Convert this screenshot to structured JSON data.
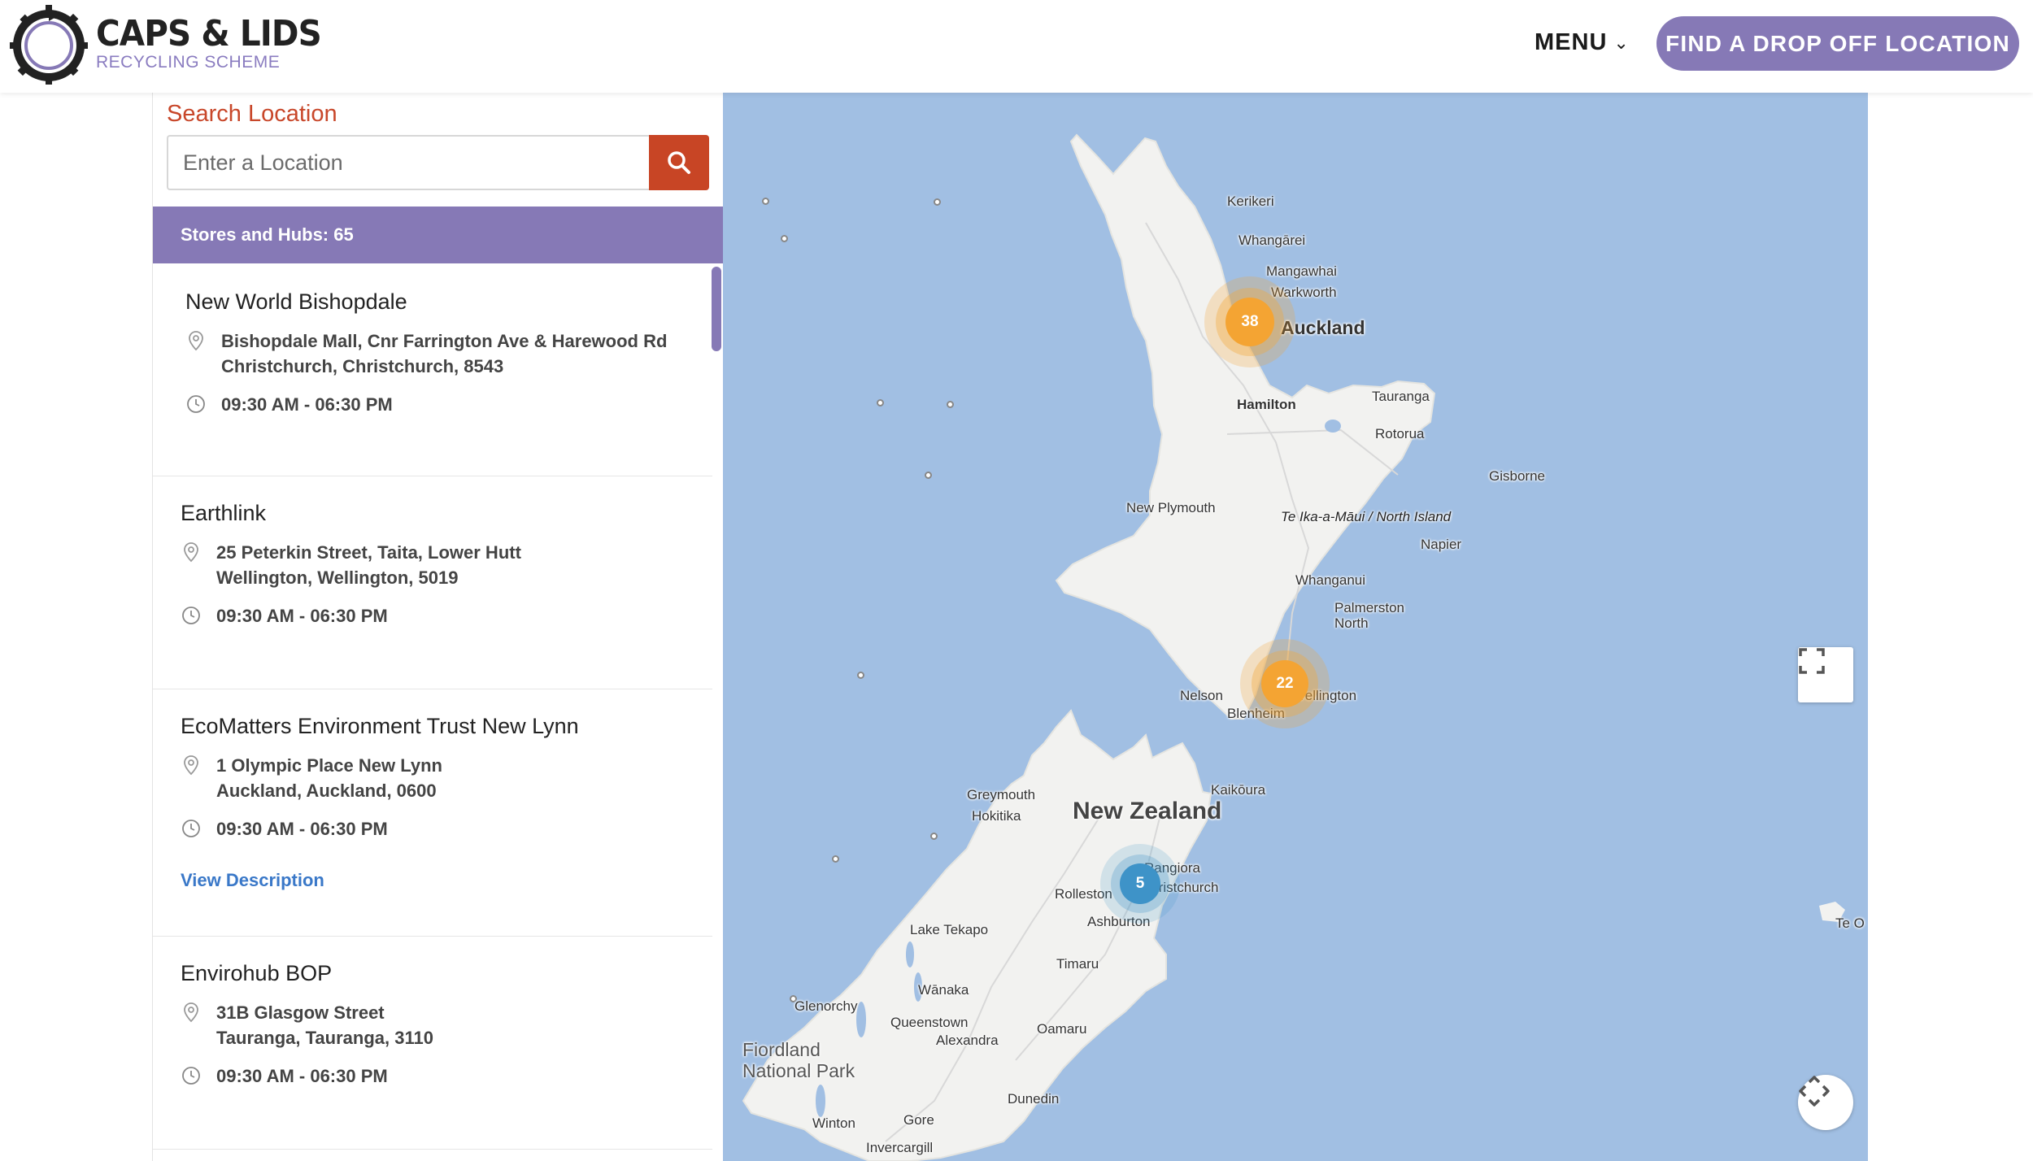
{
  "header": {
    "logo_title": "CAPS & LIDS",
    "logo_subtitle": "RECYCLING SCHEME",
    "menu_label": "MENU",
    "cta_label": "FIND A DROP OFF LOCATION",
    "brand_color": "#8679b6"
  },
  "search": {
    "label": "Search Location",
    "placeholder": "Enter a Location",
    "button_color": "#c84525"
  },
  "summary": {
    "count_text": "Stores and Hubs: 65"
  },
  "stores": [
    {
      "name": "New World Bishopdale",
      "address_line1": "Bishopdale Mall, Cnr Farrington Ave & Harewood Rd",
      "address_line2": "Christchurch, Christchurch, 8543",
      "hours": "09:30 AM - 06:30 PM"
    },
    {
      "name": "Earthlink",
      "address_line1": "25 Peterkin Street, Taita, Lower Hutt",
      "address_line2": "Wellington, Wellington, 5019",
      "hours": "09:30 AM - 06:30 PM"
    },
    {
      "name": "EcoMatters Environment Trust New Lynn",
      "address_line1": "1 Olympic Place New Lynn",
      "address_line2": "Auckland, Auckland, 0600",
      "hours": "09:30 AM - 06:30 PM",
      "link": "View Description"
    },
    {
      "name": "Envirohub BOP",
      "address_line1": "31B Glasgow Street",
      "address_line2": "Tauranga, Tauranga, 3110",
      "hours": "09:30 AM - 06:30 PM"
    }
  ],
  "map": {
    "country_label": "New Zealand",
    "north_island_label": "Te Ika-a-Māui / North Island",
    "park_label": "Fiordland National Park",
    "places": [
      "Kerikeri",
      "Whangārei",
      "Mangawhai",
      "Warkworth",
      "Auckland",
      "Hamilton",
      "Tauranga",
      "Rotorua",
      "Gisborne",
      "New Plymouth",
      "Napier",
      "Whanganui",
      "Palmerston North",
      "Nelson",
      "Blenheim",
      "Wellington",
      "Greymouth",
      "Hokitika",
      "Kaikōura",
      "Rangiora",
      "Christchurch",
      "Rolleston",
      "Ashburton",
      "Lake Tekapo",
      "Timaru",
      "Glenorchy",
      "Wānaka",
      "Queenstown",
      "Alexandra",
      "Oamaru",
      "Dunedin",
      "Winton",
      "Gore",
      "Invercargill",
      "Te O"
    ],
    "clusters": [
      {
        "count": "38",
        "color": "#f4a534",
        "location": "Auckland"
      },
      {
        "count": "22",
        "color": "#f4a534",
        "location": "Wellington"
      },
      {
        "count": "5",
        "color": "#3f93c9",
        "location": "Christchurch"
      }
    ],
    "sea_color": "#a1bfe3",
    "land_color": "#f2f2f0"
  }
}
